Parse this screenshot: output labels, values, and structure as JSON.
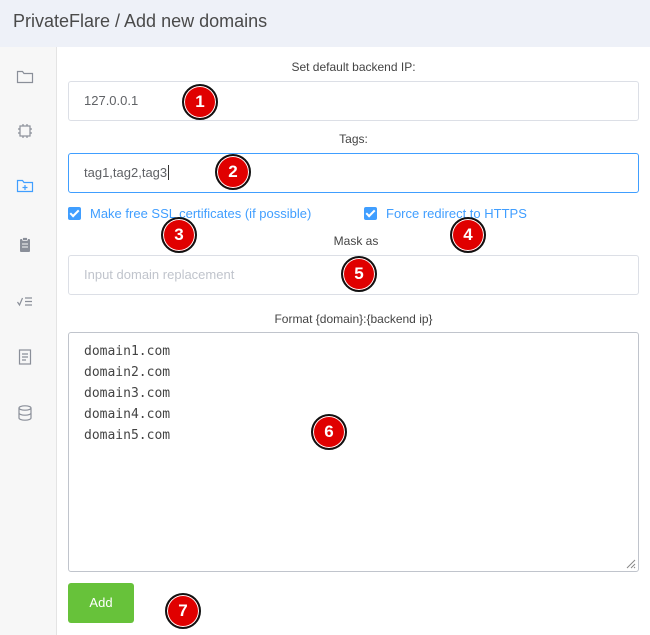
{
  "header": {
    "title": "PrivateFlare / Add new domains"
  },
  "sidebar": {
    "icons": [
      "folder-icon",
      "chip-icon",
      "folder-plus-icon",
      "clipboard-icon",
      "checklist-icon",
      "document-icon",
      "database-icon"
    ]
  },
  "form": {
    "backend_ip_label": "Set default backend IP:",
    "backend_ip_value": "127.0.0.1",
    "tags_label": "Tags:",
    "tags_value": "tag1,tag2,tag3",
    "ssl_label": "Make free SSL certificates (if possible)",
    "redirect_label": "Force redirect to HTTPS",
    "mask_label": "Mask as",
    "mask_placeholder": "Input domain replacement",
    "format_label": "Format {domain}:{backend ip}",
    "domains": [
      "domain1.com",
      "domain2.com",
      "domain3.com",
      "domain4.com",
      "domain5.com"
    ],
    "add_label": "Add"
  },
  "annotations": [
    "1",
    "2",
    "3",
    "4",
    "5",
    "6",
    "7"
  ],
  "colors": {
    "accent": "#409eff",
    "add_button": "#67c23a",
    "badge": "#e00000"
  }
}
